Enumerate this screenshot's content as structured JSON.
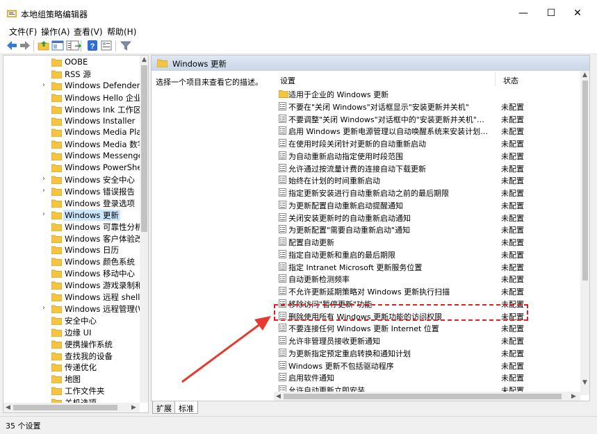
{
  "window": {
    "title": "本地组策略编辑器",
    "minimize_glyph": "—",
    "maximize_glyph": "☐",
    "close_glyph": "✕"
  },
  "menu": [
    "文件(F)",
    "操作(A)",
    "查看(V)",
    "帮助(H)"
  ],
  "toolbar_icons": [
    "back-icon",
    "forward-icon",
    "up-folder-icon",
    "show-hide-tree-icon",
    "export-icon",
    "help-icon",
    "properties-icon",
    "filter-icon"
  ],
  "tree": {
    "items": [
      {
        "label": "OOBE",
        "expandable": false
      },
      {
        "label": "RSS 源",
        "expandable": false
      },
      {
        "label": "Windows Defender Sr",
        "expandable": true
      },
      {
        "label": "Windows Hello 企业版",
        "expandable": false
      },
      {
        "label": "Windows Ink 工作区",
        "expandable": false
      },
      {
        "label": "Windows Installer",
        "expandable": false
      },
      {
        "label": "Windows Media Playe",
        "expandable": false
      },
      {
        "label": "Windows Media 数字权",
        "expandable": false
      },
      {
        "label": "Windows Messenger",
        "expandable": false
      },
      {
        "label": "Windows PowerShell",
        "expandable": false
      },
      {
        "label": "Windows 安全中心",
        "expandable": true
      },
      {
        "label": "Windows 错误报告",
        "expandable": true
      },
      {
        "label": "Windows 登录选项",
        "expandable": false
      },
      {
        "label": "Windows 更新",
        "expandable": true,
        "selected": true
      },
      {
        "label": "Windows 可靠性分析",
        "expandable": false
      },
      {
        "label": "Windows 客户体验改善",
        "expandable": false
      },
      {
        "label": "Windows 日历",
        "expandable": false
      },
      {
        "label": "Windows 颜色系统",
        "expandable": false
      },
      {
        "label": "Windows 移动中心",
        "expandable": false
      },
      {
        "label": "Windows 游戏录制和广",
        "expandable": false
      },
      {
        "label": "Windows 远程 shell",
        "expandable": false
      },
      {
        "label": "Windows 远程管理(Wi",
        "expandable": true
      },
      {
        "label": "安全中心",
        "expandable": false
      },
      {
        "label": "边缘 UI",
        "expandable": false
      },
      {
        "label": "便携操作系统",
        "expandable": false
      },
      {
        "label": "查找我的设备",
        "expandable": false
      },
      {
        "label": "传递优化",
        "expandable": false
      },
      {
        "label": "地图",
        "expandable": false
      },
      {
        "label": "工作文件夹",
        "expandable": false
      },
      {
        "label": "关机选项",
        "expandable": false
      }
    ]
  },
  "right": {
    "header_title": "Windows 更新",
    "description": "选择一个项目来查看它的描述。",
    "col_setting": "设置",
    "col_state": "状态",
    "rows": [
      {
        "name": "适用于企业的 Windows 更新",
        "state": "",
        "folder": true
      },
      {
        "name": "不要在\"关闭 Windows\"对话框显示\"安装更新并关机\"",
        "state": "未配置"
      },
      {
        "name": "不要调整\"关闭 Windows\"对话框中的\"安装更新并关机\"的默...",
        "state": "未配置"
      },
      {
        "name": "启用 Windows 更新电源管理以自动唤醒系统来安装计划的...",
        "state": "未配置"
      },
      {
        "name": "在使用时段关闭针对更新的自动重新启动",
        "state": "未配置"
      },
      {
        "name": "为自动重新启动指定使用时段范围",
        "state": "未配置"
      },
      {
        "name": "允许通过按流量计费的连接自动下载更新",
        "state": "未配置"
      },
      {
        "name": "始终在计划的时间重新启动",
        "state": "未配置"
      },
      {
        "name": "指定更新安装进行自动重新启动之前的最后期限",
        "state": "未配置"
      },
      {
        "name": "为更新配置自动重新启动提醒通知",
        "state": "未配置"
      },
      {
        "name": "关闭安装更新时的自动重新启动通知",
        "state": "未配置"
      },
      {
        "name": "为更新配置\"需要自动重新启动\"通知",
        "state": "未配置"
      },
      {
        "name": "配置自动更新",
        "state": "未配置"
      },
      {
        "name": "指定自动更新和重启的最后期限",
        "state": "未配置"
      },
      {
        "name": "指定 Intranet Microsoft 更新服务位置",
        "state": "未配置"
      },
      {
        "name": "自动更新检测频率",
        "state": "未配置"
      },
      {
        "name": "不允许更新延期策略对 Windows 更新执行扫描",
        "state": "未配置"
      },
      {
        "name": "移除访问\"暂停更新\"功能",
        "state": "未配置"
      },
      {
        "name": "删除使用所有 Windows 更新功能的访问权限",
        "state": "未配置"
      },
      {
        "name": "不要连接任何 Windows 更新 Internet 位置",
        "state": "未配置"
      },
      {
        "name": "允许非管理员接收更新通知",
        "state": "未配置"
      },
      {
        "name": "为更新指定预定重启转换和通知计划",
        "state": "未配置"
      },
      {
        "name": "Windows 更新不包括驱动程序",
        "state": "未配置"
      },
      {
        "name": "启用软件通知",
        "state": "未配置"
      },
      {
        "name": "允许自动更新立即安装",
        "state": "未配置"
      }
    ]
  },
  "tabs": [
    "扩展",
    "标准"
  ],
  "status": "35 个设置",
  "colors": {
    "selection": "#cce8ff",
    "highlight": "#e02020",
    "folder": "#f5c542"
  }
}
